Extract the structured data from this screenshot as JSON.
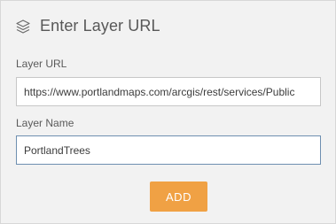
{
  "header": {
    "title": "Enter Layer URL",
    "icon": "layers-icon"
  },
  "layer_url": {
    "label": "Layer URL",
    "value": "https://www.portlandmaps.com/arcgis/rest/services/Public"
  },
  "layer_name": {
    "label": "Layer Name",
    "value": "PortlandTrees"
  },
  "actions": {
    "add_label": "ADD"
  },
  "colors": {
    "accent": "#f0a144",
    "focus_border": "#6e8fb0"
  }
}
